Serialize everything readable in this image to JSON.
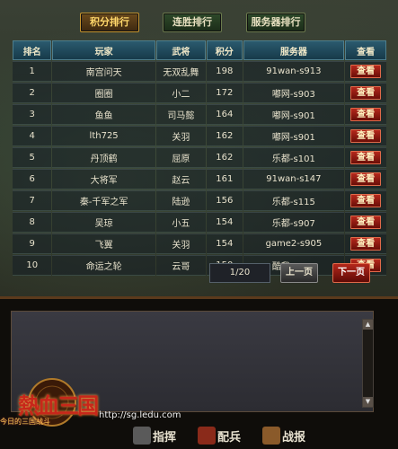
{
  "tabs": [
    {
      "label": "积分排行",
      "active": true
    },
    {
      "label": "连胜排行",
      "active": false
    },
    {
      "label": "服务器排行",
      "active": false
    }
  ],
  "table": {
    "headers": [
      "排名",
      "玩家",
      "武将",
      "积分",
      "服务器",
      "查看"
    ],
    "view_label": "查看",
    "rows": [
      {
        "rank": "1",
        "player": "南宫问天",
        "general": "无双乱舞",
        "score": "198",
        "server": "91wan-s913"
      },
      {
        "rank": "2",
        "player": "圈圈",
        "general": "小二",
        "score": "172",
        "server": "嘟网-s903"
      },
      {
        "rank": "3",
        "player": "鱼鱼",
        "general": "司马懿",
        "score": "164",
        "server": "嘟网-s901"
      },
      {
        "rank": "4",
        "player": "lth725",
        "general": "关羽",
        "score": "162",
        "server": "嘟网-s901"
      },
      {
        "rank": "5",
        "player": "丹顶鹤",
        "general": "屈原",
        "score": "162",
        "server": "乐都-s101"
      },
      {
        "rank": "6",
        "player": "大将军",
        "general": "赵云",
        "score": "161",
        "server": "91wan-s147"
      },
      {
        "rank": "7",
        "player": "秦-千军之军",
        "general": "陆逊",
        "score": "156",
        "server": "乐都-s115"
      },
      {
        "rank": "8",
        "player": "吴琼",
        "general": "小五",
        "score": "154",
        "server": "乐都-s907"
      },
      {
        "rank": "9",
        "player": "飞翼",
        "general": "关羽",
        "score": "154",
        "server": "game2-s905"
      },
      {
        "rank": "10",
        "player": "命运之轮",
        "general": "云哥",
        "score": "150",
        "server": "酷我-s903"
      }
    ]
  },
  "pager": {
    "page": "1/20",
    "prev": "上一页",
    "next": "下一页"
  },
  "footer": {
    "logo_text": "熱血三国",
    "logo_sub": "今日的三国战斗",
    "url": "http://sg.ledu.com",
    "nav": [
      {
        "label": "指挥",
        "icon": "helmet-icon",
        "color": "#6a6a6a"
      },
      {
        "label": "配兵",
        "icon": "soldier-icon",
        "color": "#8a2a1a"
      },
      {
        "label": "战报",
        "icon": "scroll-icon",
        "color": "#8a5a2a"
      }
    ]
  },
  "colors": {
    "accent": "#c8952e",
    "danger": "#b5281c",
    "header": "#2b5a6e"
  }
}
